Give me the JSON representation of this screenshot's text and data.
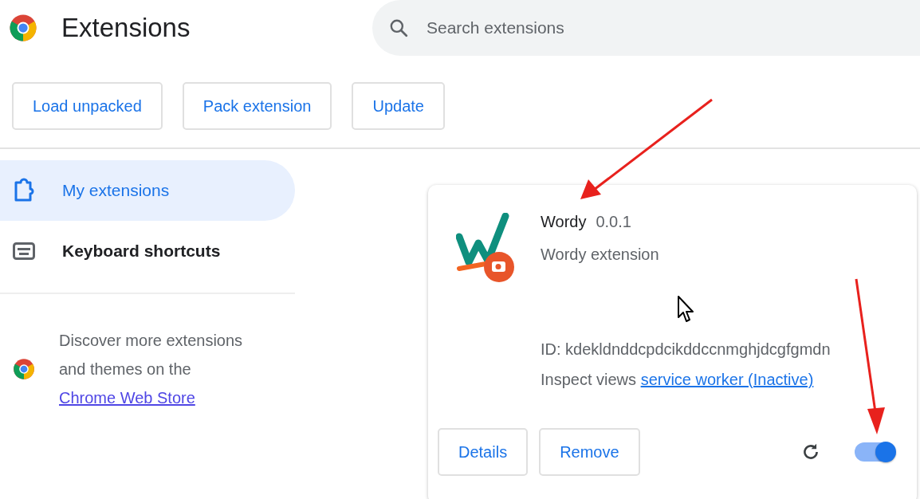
{
  "header": {
    "title": "Extensions",
    "search": {
      "placeholder": "Search extensions"
    }
  },
  "toolbar": {
    "buttons": [
      "Load unpacked",
      "Pack extension",
      "Update"
    ]
  },
  "sidebar": {
    "items": [
      {
        "label": "My extensions",
        "kind": "puzzle",
        "selected": true
      },
      {
        "label": "Keyboard shortcuts",
        "kind": "keyboard",
        "selected": false
      }
    ],
    "promo": {
      "text": "Discover more extensions and themes on the",
      "link": "Chrome Web Store"
    }
  },
  "extension": {
    "name": "Wordy",
    "version": "0.0.1",
    "description": "Wordy extension",
    "id": "ID: kdekldnddcpdcikddccnmghjdcgfgmdn",
    "inspect_label": "Inspect views",
    "inspect_link": "service worker (Inactive)",
    "buttons": [
      "Details",
      "Remove"
    ],
    "enabled": true
  }
}
